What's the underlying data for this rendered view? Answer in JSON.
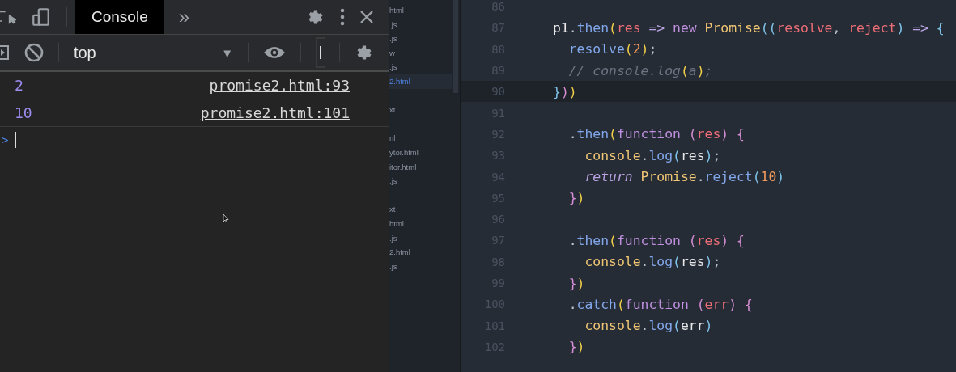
{
  "devtools": {
    "tabs": [
      {
        "label": "Console",
        "selected": true
      }
    ],
    "more_tabs": "»",
    "context": "top",
    "dropdown_arrow": "▼",
    "messages": [
      {
        "value": "2",
        "source": "promise2.html:93"
      },
      {
        "value": "10",
        "source": "promise2.html:101"
      }
    ],
    "prompt": ">"
  },
  "file_tree": {
    "groups": [
      [
        {
          "name": "html",
          "selected": false
        },
        {
          "name": ".js",
          "selected": false
        },
        {
          "name": ".js",
          "selected": false
        },
        {
          "name": "w",
          "selected": false
        },
        {
          "name": ".js",
          "selected": false
        },
        {
          "name": "2.html",
          "selected": true
        }
      ],
      [
        {
          "name": "xt",
          "selected": false
        }
      ],
      [
        {
          "name": "nl",
          "selected": false
        },
        {
          "name": "ytor.html",
          "selected": false
        },
        {
          "name": "itor.html",
          "selected": false
        },
        {
          "name": ".js",
          "selected": false
        }
      ],
      [
        {
          "name": "xt",
          "selected": false
        },
        {
          "name": "html",
          "selected": false
        },
        {
          "name": ".js",
          "selected": false
        },
        {
          "name": "2.html",
          "selected": false
        },
        {
          "name": ".js",
          "selected": false
        }
      ]
    ]
  },
  "editor": {
    "lines": [
      {
        "number": "86",
        "current": false
      },
      {
        "number": "87",
        "current": false,
        "tokens": [
          {
            "text": "p1",
            "kind": "plain"
          },
          {
            "text": ".",
            "kind": "punct"
          },
          {
            "text": "then",
            "kind": "fn"
          },
          {
            "text": "(",
            "kind": "p1"
          },
          {
            "text": "res",
            "kind": "param"
          },
          {
            "text": " => ",
            "kind": "op"
          },
          {
            "text": "new ",
            "kind": "kw"
          },
          {
            "text": "Promise",
            "kind": "cls"
          },
          {
            "text": "((",
            "kind": "p3"
          },
          {
            "text": "resolve",
            "kind": "param"
          },
          {
            "text": ", ",
            "kind": "punct"
          },
          {
            "text": "reject",
            "kind": "param"
          },
          {
            "text": ")",
            "kind": "p3"
          },
          {
            "text": " => ",
            "kind": "op"
          },
          {
            "text": "{",
            "kind": "p3"
          }
        ]
      },
      {
        "number": "88",
        "current": false,
        "tokens": [
          {
            "text": "  resolve",
            "kind": "fn"
          },
          {
            "text": "(",
            "kind": "p1"
          },
          {
            "text": "2",
            "kind": "num"
          },
          {
            "text": ")",
            "kind": "p1"
          },
          {
            "text": ";",
            "kind": "punct"
          }
        ]
      },
      {
        "number": "89",
        "current": false,
        "tokens": [
          {
            "text": "  // console.log",
            "kind": "comment"
          },
          {
            "text": "(",
            "kind": "p1"
          },
          {
            "text": "a",
            "kind": "comment"
          },
          {
            "text": ")",
            "kind": "p1"
          },
          {
            "text": ";",
            "kind": "comment"
          }
        ]
      },
      {
        "number": "90",
        "current": true,
        "tokens": [
          {
            "text": "}",
            "kind": "p3"
          },
          {
            "text": ")",
            "kind": "p2"
          },
          {
            "text": ")",
            "kind": "p1"
          }
        ]
      },
      {
        "number": "91",
        "current": false
      },
      {
        "number": "92",
        "current": false,
        "tokens": [
          {
            "text": "  .",
            "kind": "punct"
          },
          {
            "text": "then",
            "kind": "fn"
          },
          {
            "text": "(",
            "kind": "p1"
          },
          {
            "text": "function",
            "kind": "kw"
          },
          {
            "text": " (",
            "kind": "p2"
          },
          {
            "text": "res",
            "kind": "param"
          },
          {
            "text": ") {",
            "kind": "p2"
          }
        ]
      },
      {
        "number": "93",
        "current": false,
        "tokens": [
          {
            "text": "    console",
            "kind": "cls"
          },
          {
            "text": ".",
            "kind": "punct"
          },
          {
            "text": "log",
            "kind": "fn"
          },
          {
            "text": "(",
            "kind": "p3"
          },
          {
            "text": "res",
            "kind": "plain"
          },
          {
            "text": ")",
            "kind": "p3"
          },
          {
            "text": ";",
            "kind": "punct"
          }
        ]
      },
      {
        "number": "94",
        "current": false,
        "tokens": [
          {
            "text": "    return ",
            "kind": "ret"
          },
          {
            "text": "Promise",
            "kind": "cls"
          },
          {
            "text": ".",
            "kind": "punct"
          },
          {
            "text": "reject",
            "kind": "fn"
          },
          {
            "text": "(",
            "kind": "p3"
          },
          {
            "text": "10",
            "kind": "num"
          },
          {
            "text": ")",
            "kind": "p3"
          }
        ]
      },
      {
        "number": "95",
        "current": false,
        "tokens": [
          {
            "text": "  }",
            "kind": "p2"
          },
          {
            "text": ")",
            "kind": "p1"
          }
        ]
      },
      {
        "number": "96",
        "current": false
      },
      {
        "number": "97",
        "current": false,
        "tokens": [
          {
            "text": "  .",
            "kind": "punct"
          },
          {
            "text": "then",
            "kind": "fn"
          },
          {
            "text": "(",
            "kind": "p1"
          },
          {
            "text": "function",
            "kind": "kw"
          },
          {
            "text": " (",
            "kind": "p2"
          },
          {
            "text": "res",
            "kind": "param"
          },
          {
            "text": ") {",
            "kind": "p2"
          }
        ]
      },
      {
        "number": "98",
        "current": false,
        "tokens": [
          {
            "text": "    console",
            "kind": "cls"
          },
          {
            "text": ".",
            "kind": "punct"
          },
          {
            "text": "log",
            "kind": "fn"
          },
          {
            "text": "(",
            "kind": "p3"
          },
          {
            "text": "res",
            "kind": "plain"
          },
          {
            "text": ")",
            "kind": "p3"
          },
          {
            "text": ";",
            "kind": "punct"
          }
        ]
      },
      {
        "number": "99",
        "current": false,
        "tokens": [
          {
            "text": "  }",
            "kind": "p2"
          },
          {
            "text": ")",
            "kind": "p1"
          }
        ]
      },
      {
        "number": "100",
        "current": false,
        "tokens": [
          {
            "text": "  .",
            "kind": "punct"
          },
          {
            "text": "catch",
            "kind": "fn"
          },
          {
            "text": "(",
            "kind": "p1"
          },
          {
            "text": "function",
            "kind": "kw"
          },
          {
            "text": " (",
            "kind": "p2"
          },
          {
            "text": "err",
            "kind": "param"
          },
          {
            "text": ") {",
            "kind": "p2"
          }
        ]
      },
      {
        "number": "101",
        "current": false,
        "tokens": [
          {
            "text": "    console",
            "kind": "cls"
          },
          {
            "text": ".",
            "kind": "punct"
          },
          {
            "text": "log",
            "kind": "fn"
          },
          {
            "text": "(",
            "kind": "p3"
          },
          {
            "text": "err",
            "kind": "plain"
          },
          {
            "text": ")",
            "kind": "p3"
          }
        ]
      },
      {
        "number": "102",
        "current": false,
        "tokens": [
          {
            "text": "  }",
            "kind": "p2"
          },
          {
            "text": ")",
            "kind": "p1"
          }
        ]
      }
    ]
  }
}
